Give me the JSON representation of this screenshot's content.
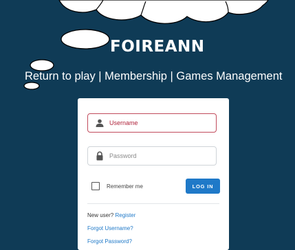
{
  "header": {
    "brand": "FOIREANN",
    "tagline": "Return to play | Membership | Games Management"
  },
  "login_form": {
    "username_placeholder": "Username",
    "password_placeholder": "Password",
    "remember_label": "Remember me",
    "login_button": "LOG IN",
    "new_user_text": "New user?",
    "register_link": "Register",
    "forgot_username_link": "Forgot Username?",
    "forgot_password_link": "Forgot Password?"
  },
  "colors": {
    "background": "#0f3b56",
    "accent": "#1f79c8",
    "error": "#c14b5c"
  },
  "icons": {
    "username": "user-icon",
    "password": "lock-icon"
  }
}
